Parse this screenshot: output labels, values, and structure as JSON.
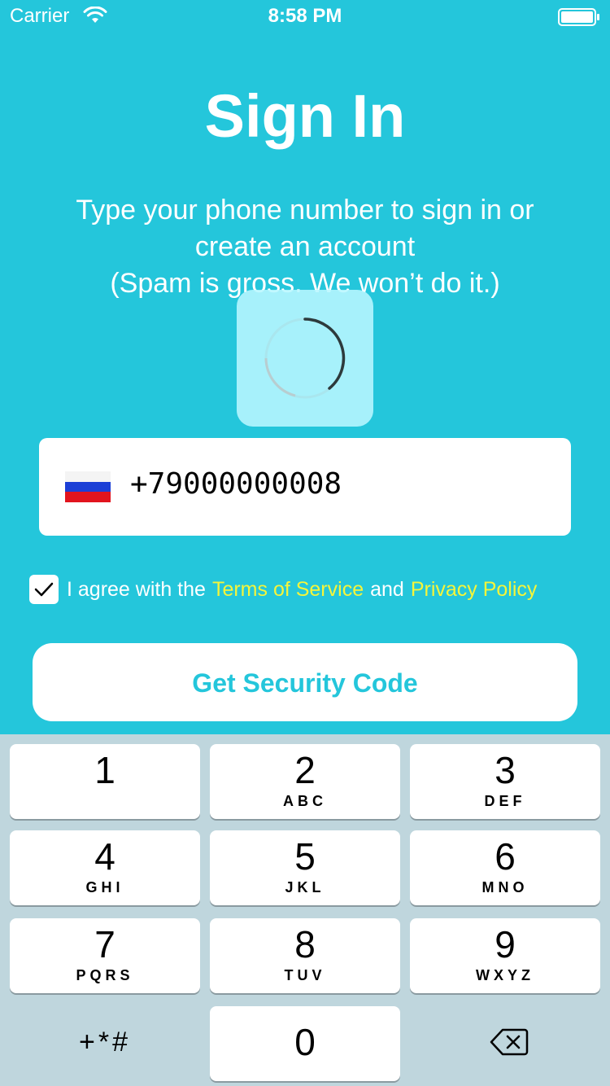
{
  "status_bar": {
    "carrier": "Carrier",
    "time": "8:58 PM"
  },
  "title": "Sign In",
  "subtitle": {
    "line1": "Type your phone number to sign in or",
    "line2": "create an account",
    "line3": "(Spam is gross. We won’t do it.)"
  },
  "phone": {
    "country_flag": "russia-flag-icon",
    "value": "+79000000008"
  },
  "agreement": {
    "checked": true,
    "prefix": "I agree with the",
    "terms_link": "Terms of Service",
    "and": "and",
    "privacy_link": "Privacy Policy"
  },
  "cta_label": "Get Security Code",
  "keyboard": {
    "keys": [
      {
        "digit": "1",
        "letters": ""
      },
      {
        "digit": "2",
        "letters": "ABC"
      },
      {
        "digit": "3",
        "letters": "DEF"
      },
      {
        "digit": "4",
        "letters": "GHI"
      },
      {
        "digit": "5",
        "letters": "JKL"
      },
      {
        "digit": "6",
        "letters": "MNO"
      },
      {
        "digit": "7",
        "letters": "PQRS"
      },
      {
        "digit": "8",
        "letters": "TUV"
      },
      {
        "digit": "9",
        "letters": "WXYZ"
      },
      {
        "digit": "0",
        "letters": ""
      }
    ],
    "symbols": "+*#"
  },
  "colors": {
    "background": "#24c6db",
    "link": "#f5f53a",
    "keyboard": "#bfd6dd"
  }
}
